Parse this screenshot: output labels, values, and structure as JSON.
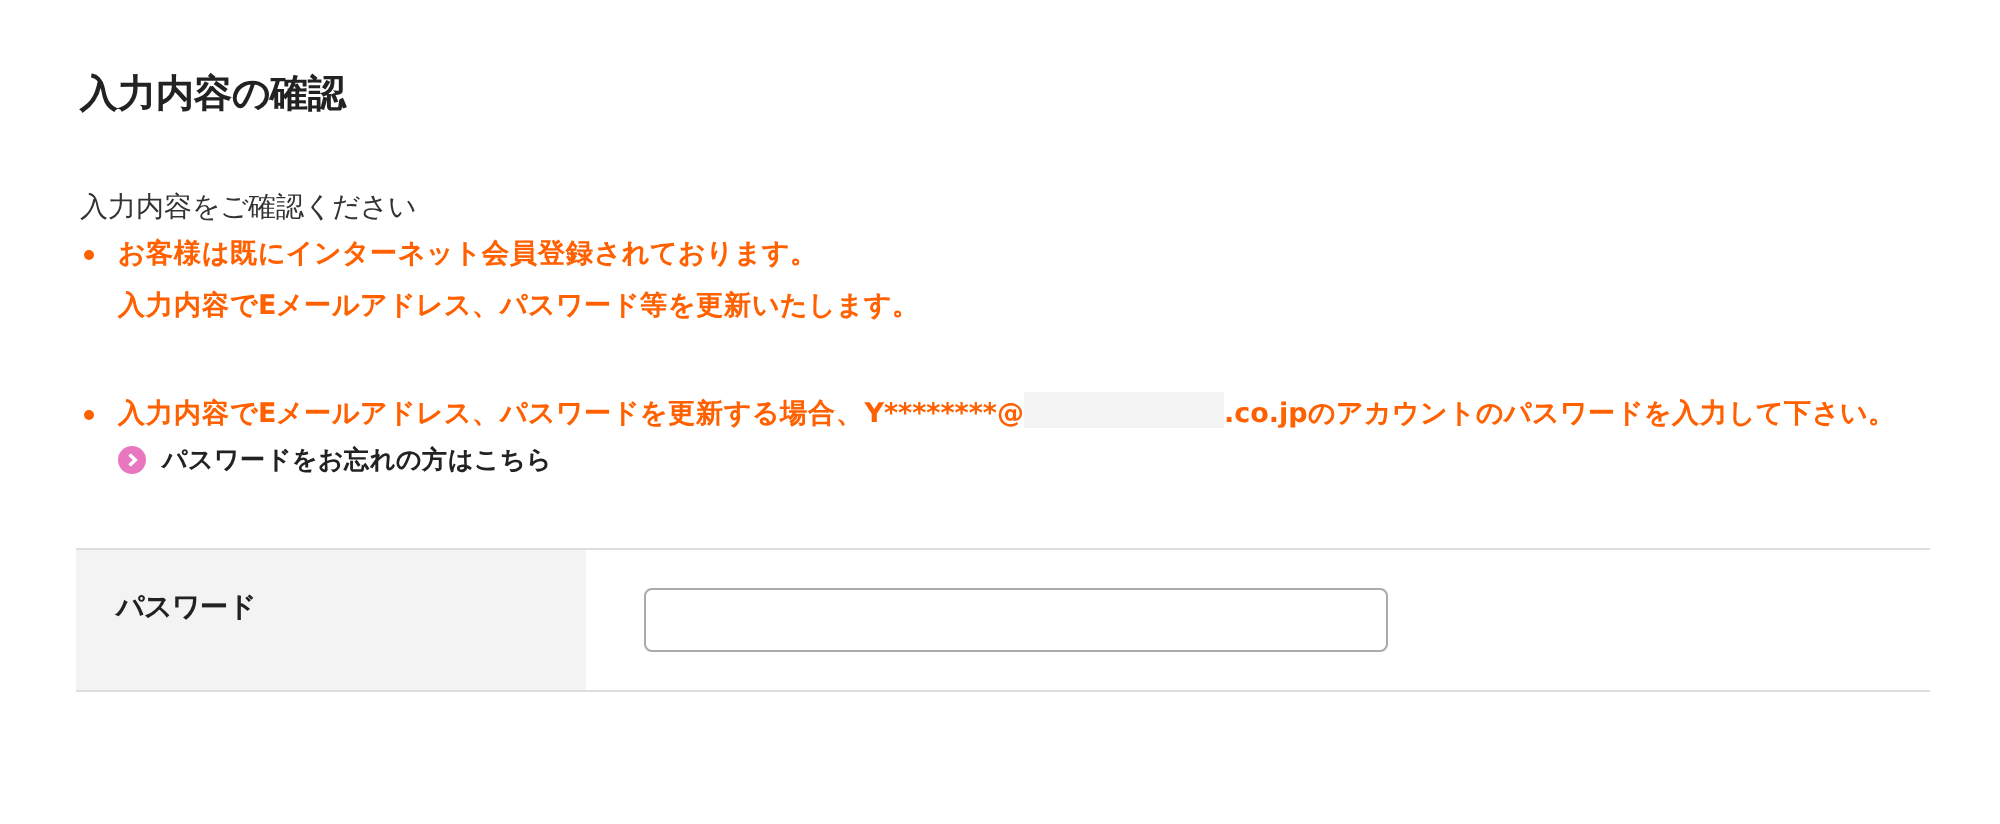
{
  "heading": "入力内容の確認",
  "intro": "入力内容をご確認ください",
  "notices": [
    {
      "kind": "lines",
      "lines": [
        "お客様は既にインターネット会員登録されております。",
        "入力内容でEメールアドレス、パスワード等を更新いたします。"
      ]
    },
    {
      "kind": "masked",
      "before": "入力内容でEメールアドレス、パスワードを更新する場合、Y********@",
      "after": ".co.jpのアカウントのパスワードを入力して下さい。"
    }
  ],
  "forgot_link": "パスワードをお忘れの方はこちら",
  "form": {
    "rows": [
      {
        "label": "パスワード"
      }
    ]
  }
}
